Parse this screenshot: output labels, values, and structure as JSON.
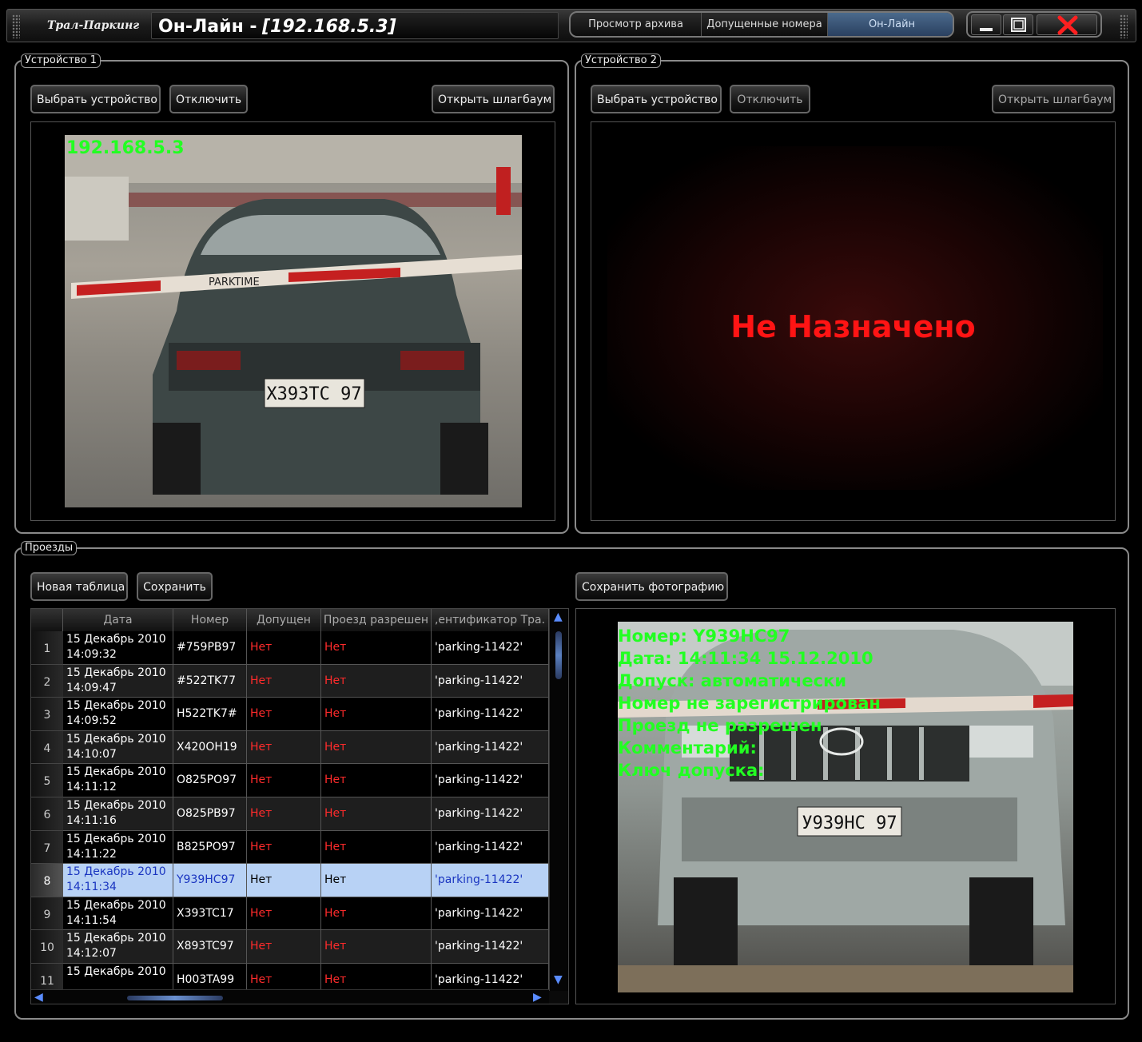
{
  "app": {
    "brand": "Трал-Паркинг",
    "title_prefix": "Он-Лайн -",
    "title_ip": "[192.168.5.3]"
  },
  "nav": {
    "archive": "Просмотр архива",
    "allowed": "Допущенные номера",
    "online": "Он-Лайн"
  },
  "device1": {
    "legend": "Устройство 1",
    "select": "Выбрать устройство",
    "disconnect": "Отключить",
    "open_barrier": "Открыть шлагбаум",
    "overlay_ip": "192.168.5.3",
    "barrier_text": "PARKTIME",
    "plate": "X393TC 97"
  },
  "device2": {
    "legend": "Устройство 2",
    "select": "Выбрать устройство",
    "disconnect": "Отключить",
    "open_barrier": "Открыть шлагбаум",
    "not_assigned": "Не Назначено"
  },
  "passes": {
    "legend": "Проезды",
    "new_table": "Новая таблица",
    "save": "Сохранить",
    "save_photo": "Сохранить фотографию",
    "columns": [
      "Дата",
      "Номер",
      "Допущен",
      "Проезд разрешен",
      ",ентификатор Тра."
    ],
    "rows": [
      {
        "n": "1",
        "date": "15 Декабрь 2010",
        "time": "14:09:32",
        "plate": "#759PB97",
        "allowed": "Нет",
        "pass": "Нет",
        "id": "'parking-11422'"
      },
      {
        "n": "2",
        "date": "15 Декабрь 2010",
        "time": "14:09:47",
        "plate": "#522TK77",
        "allowed": "Нет",
        "pass": "Нет",
        "id": "'parking-11422'"
      },
      {
        "n": "3",
        "date": "15 Декабрь 2010",
        "time": "14:09:52",
        "plate": "H522TK7#",
        "allowed": "Нет",
        "pass": "Нет",
        "id": "'parking-11422'"
      },
      {
        "n": "4",
        "date": "15 Декабрь 2010",
        "time": "14:10:07",
        "plate": "X420OH19",
        "allowed": "Нет",
        "pass": "Нет",
        "id": "'parking-11422'"
      },
      {
        "n": "5",
        "date": "15 Декабрь 2010",
        "time": "14:11:12",
        "plate": "O825PO97",
        "allowed": "Нет",
        "pass": "Нет",
        "id": "'parking-11422'"
      },
      {
        "n": "6",
        "date": "15 Декабрь 2010",
        "time": "14:11:16",
        "plate": "O825PB97",
        "allowed": "Нет",
        "pass": "Нет",
        "id": "'parking-11422'"
      },
      {
        "n": "7",
        "date": "15 Декабрь 2010",
        "time": "14:11:22",
        "plate": "B825PO97",
        "allowed": "Нет",
        "pass": "Нет",
        "id": "'parking-11422'"
      },
      {
        "n": "8",
        "date": "15 Декабрь 2010",
        "time": "14:11:34",
        "plate": "Y939HC97",
        "allowed": "Нет",
        "pass": "Нет",
        "id": "'parking-11422'"
      },
      {
        "n": "9",
        "date": "15 Декабрь 2010",
        "time": "14:11:54",
        "plate": "X393TC17",
        "allowed": "Нет",
        "pass": "Нет",
        "id": "'parking-11422'"
      },
      {
        "n": "10",
        "date": "15 Декабрь 2010",
        "time": "14:12:07",
        "plate": "X893TC97",
        "allowed": "Нет",
        "pass": "Нет",
        "id": "'parking-11422'"
      },
      {
        "n": "11",
        "date": "15 Декабрь 2010",
        "time": "",
        "plate": "H003TA99",
        "allowed": "Нет",
        "pass": "Нет",
        "id": "'parking-11422'"
      }
    ],
    "selected_row": 8
  },
  "photo": {
    "lines": [
      "Номер: Y939HC97",
      "Дата: 14:11:34 15.12.2010",
      "Допуск: автоматически",
      "Номер не зарегистрирован",
      "Проезд не разрешен",
      "Комментарий:",
      "Ключ допуска:"
    ],
    "plate": "У939НС 97"
  },
  "colors": {
    "accent_green": "#22ff22",
    "warning_red": "#ff1414",
    "selection": "#b8d2f5"
  }
}
